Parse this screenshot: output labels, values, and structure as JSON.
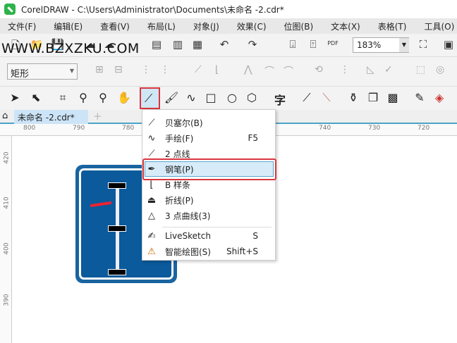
{
  "window": {
    "title": "CorelDRAW - C:\\Users\\Administrator\\Documents\\未命名 -2.cdr*"
  },
  "menubar": [
    "文件(F)",
    "编辑(E)",
    "查看(V)",
    "布局(L)",
    "对象(J)",
    "效果(C)",
    "位图(B)",
    "文本(X)",
    "表格(T)",
    "工具(O)"
  ],
  "toolbar": {
    "zoom": "183%",
    "pdf_label": "PDF"
  },
  "watermark": "WWW.BZXZKU.COM",
  "propbar": {
    "shape_select": "矩形"
  },
  "toolbox": {
    "text_tool": "字"
  },
  "doc_tab": {
    "label": "未命名 -2.cdr*",
    "add": "+"
  },
  "ruler": {
    "h": [
      "800",
      "790",
      "780",
      "740",
      "730",
      "720"
    ],
    "v": [
      "420",
      "410",
      "400",
      "390"
    ]
  },
  "popup": {
    "items": [
      {
        "label": "贝塞尔(B)",
        "shortcut": "",
        "icon": "bezier-icon"
      },
      {
        "label": "手绘(F)",
        "shortcut": "F5",
        "icon": "freehand-icon"
      },
      {
        "label": "2 点线",
        "shortcut": "",
        "icon": "two-point-line-icon"
      },
      {
        "label": "钢笔(P)",
        "shortcut": "",
        "icon": "pen-icon"
      },
      {
        "label": "B 样条",
        "shortcut": "",
        "icon": "b-spline-icon"
      },
      {
        "label": "折线(P)",
        "shortcut": "",
        "icon": "polyline-icon"
      },
      {
        "label": "3 点曲线(3)",
        "shortcut": "",
        "icon": "three-point-curve-icon"
      },
      {
        "label": "LiveSketch",
        "shortcut": "S",
        "icon": "livesketch-icon"
      },
      {
        "label": "智能绘图(S)",
        "shortcut": "Shift+S",
        "icon": "smart-drawing-icon"
      }
    ]
  },
  "colors": {
    "highlight": "#d9363e",
    "sign": "#0a5a9c"
  }
}
